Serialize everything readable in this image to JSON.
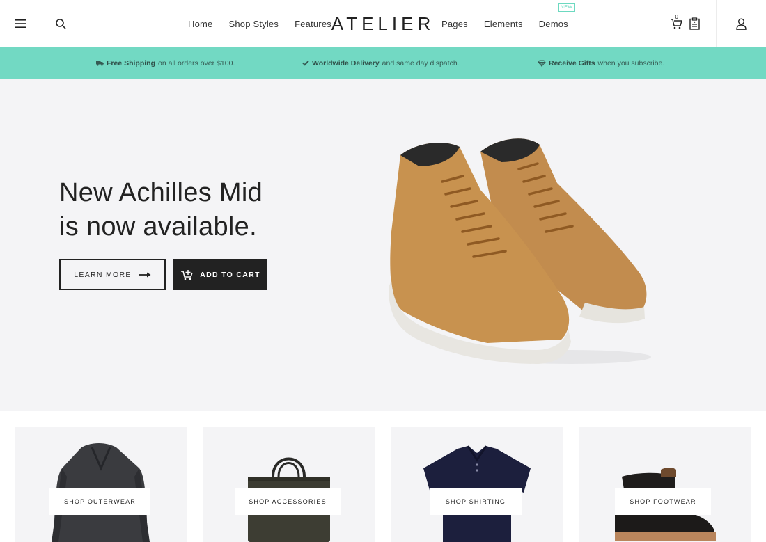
{
  "nav": {
    "left": [
      "Home",
      "Shop Styles",
      "Features"
    ],
    "right": [
      "Pages",
      "Elements",
      "Demos"
    ],
    "demos_badge": "NEW",
    "cart_count": "0"
  },
  "logo": "ATELIER",
  "promo": [
    {
      "bold": "Free Shipping",
      "text": "on all orders over $100.",
      "icon": "truck-icon"
    },
    {
      "bold": "Worldwide Delivery",
      "text": "and same day dispatch.",
      "icon": "check-icon"
    },
    {
      "bold": "Receive Gifts",
      "text": "when you subscribe.",
      "icon": "diamond-icon"
    }
  ],
  "hero": {
    "title_line1": "New Achilles Mid",
    "title_line2": "is now available.",
    "learn_more": "LEARN MORE",
    "add_to_cart": "ADD TO CART"
  },
  "categories": [
    {
      "label": "SHOP OUTERWEAR",
      "icon": "coat"
    },
    {
      "label": "SHOP ACCESSORIES",
      "icon": "bag"
    },
    {
      "label": "SHOP SHIRTING",
      "icon": "polo-shirt"
    },
    {
      "label": "SHOP FOOTWEAR",
      "icon": "boots"
    }
  ],
  "colors": {
    "accent": "#72d9c3",
    "dark": "#222222",
    "hero_bg": "#f4f4f6"
  }
}
